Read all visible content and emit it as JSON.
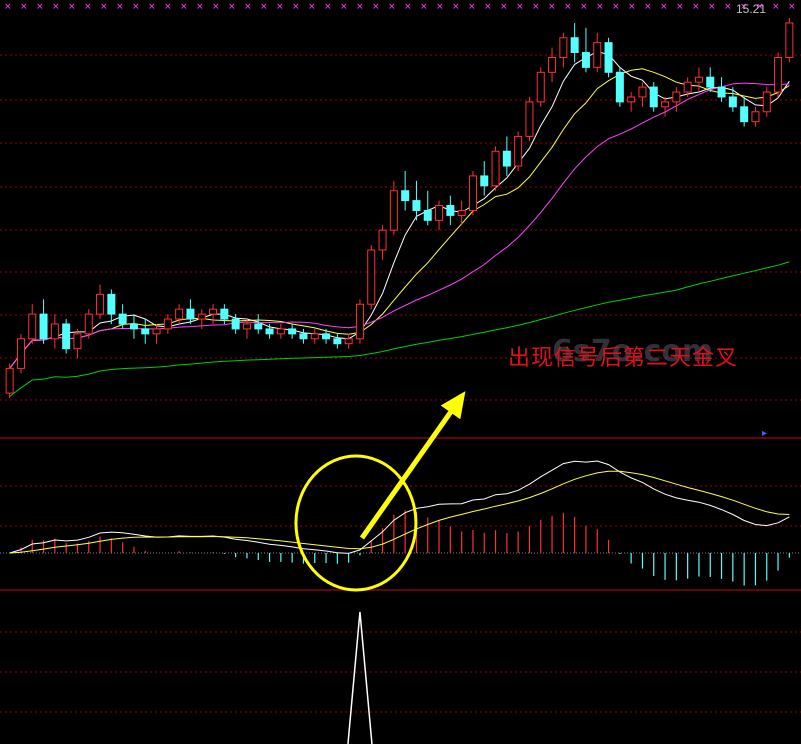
{
  "header": {
    "price_label": "15.21"
  },
  "annotation": {
    "text": "出现信号后第二天金叉",
    "color": "#e0101a"
  },
  "watermark": {
    "text": "6s7o.com"
  },
  "colors": {
    "background": "#000000",
    "up": "#ff3030",
    "down": "#54ffff",
    "ma_short": "#ffffff",
    "ma_mid": "#ffff40",
    "ma_long": "#ff40ff",
    "ma_longest": "#00d000",
    "dif": "#ffffff",
    "dea": "#ffff40",
    "grid": "#a00000",
    "highlight": "#ffff00",
    "signal": "#ffffff"
  },
  "chart_data": [
    {
      "type": "candlestick",
      "panel": "price",
      "grid": true,
      "ohlc": [
        [
          8.6,
          9.2,
          8.5,
          9.1
        ],
        [
          9.1,
          9.8,
          9.0,
          9.7
        ],
        [
          9.7,
          10.4,
          9.6,
          10.2
        ],
        [
          10.2,
          10.5,
          9.6,
          9.7
        ],
        [
          9.7,
          10.2,
          9.5,
          10.0
        ],
        [
          10.0,
          10.1,
          9.4,
          9.5
        ],
        [
          9.5,
          9.9,
          9.3,
          9.8
        ],
        [
          9.8,
          10.3,
          9.7,
          10.2
        ],
        [
          10.2,
          10.8,
          10.1,
          10.6
        ],
        [
          10.6,
          10.7,
          10.0,
          10.2
        ],
        [
          10.2,
          10.4,
          9.9,
          10.0
        ],
        [
          10.0,
          10.2,
          9.7,
          9.9
        ],
        [
          9.9,
          10.1,
          9.6,
          9.8
        ],
        [
          9.8,
          10.0,
          9.6,
          9.9
        ],
        [
          9.9,
          10.2,
          9.8,
          10.1
        ],
        [
          10.1,
          10.4,
          10.0,
          10.3
        ],
        [
          10.3,
          10.5,
          10.0,
          10.1
        ],
        [
          10.1,
          10.3,
          9.9,
          10.2
        ],
        [
          10.2,
          10.4,
          10.0,
          10.3
        ],
        [
          10.3,
          10.4,
          10.0,
          10.1
        ],
        [
          10.1,
          10.2,
          9.8,
          9.9
        ],
        [
          9.9,
          10.1,
          9.7,
          10.0
        ],
        [
          10.0,
          10.2,
          9.8,
          9.9
        ],
        [
          9.9,
          10.0,
          9.7,
          9.8
        ],
        [
          9.8,
          10.0,
          9.7,
          9.9
        ],
        [
          9.9,
          10.0,
          9.7,
          9.8
        ],
        [
          9.8,
          9.9,
          9.6,
          9.7
        ],
        [
          9.7,
          9.9,
          9.6,
          9.8
        ],
        [
          9.8,
          9.9,
          9.6,
          9.7
        ],
        [
          9.7,
          9.8,
          9.5,
          9.6
        ],
        [
          9.6,
          9.8,
          9.5,
          9.7
        ],
        [
          9.7,
          10.5,
          9.6,
          10.4
        ],
        [
          10.4,
          11.6,
          10.3,
          11.5
        ],
        [
          11.5,
          12.0,
          11.3,
          11.9
        ],
        [
          11.9,
          12.9,
          11.8,
          12.7
        ],
        [
          12.7,
          13.1,
          12.3,
          12.5
        ],
        [
          12.5,
          12.9,
          12.1,
          12.3
        ],
        [
          12.3,
          12.7,
          12.0,
          12.1
        ],
        [
          12.1,
          12.5,
          11.9,
          12.4
        ],
        [
          12.4,
          12.6,
          12.0,
          12.2
        ],
        [
          12.2,
          12.5,
          12.0,
          12.3
        ],
        [
          12.3,
          13.1,
          12.2,
          13.0
        ],
        [
          13.0,
          13.3,
          12.6,
          12.8
        ],
        [
          12.8,
          13.6,
          12.7,
          13.5
        ],
        [
          13.5,
          13.8,
          13.0,
          13.2
        ],
        [
          13.2,
          13.9,
          13.1,
          13.8
        ],
        [
          13.8,
          14.6,
          13.7,
          14.5
        ],
        [
          14.5,
          15.2,
          14.4,
          15.1
        ],
        [
          15.1,
          15.6,
          14.9,
          15.4
        ],
        [
          15.4,
          15.9,
          15.2,
          15.8
        ],
        [
          15.8,
          16.1,
          15.3,
          15.5
        ],
        [
          15.5,
          16.0,
          15.1,
          15.2
        ],
        [
          15.2,
          15.9,
          15.1,
          15.7
        ],
        [
          15.7,
          15.8,
          15.0,
          15.1
        ],
        [
          15.1,
          15.2,
          14.4,
          14.5
        ],
        [
          14.5,
          14.7,
          14.3,
          14.6
        ],
        [
          14.6,
          14.9,
          14.4,
          14.8
        ],
        [
          14.8,
          14.9,
          14.3,
          14.4
        ],
        [
          14.4,
          14.6,
          14.2,
          14.5
        ],
        [
          14.5,
          14.8,
          14.3,
          14.7
        ],
        [
          14.7,
          15.0,
          14.6,
          14.9
        ],
        [
          14.9,
          15.2,
          14.7,
          15.0
        ],
        [
          15.0,
          15.2,
          14.7,
          14.8
        ],
        [
          14.8,
          15.0,
          14.5,
          14.6
        ],
        [
          14.6,
          14.8,
          14.3,
          14.4
        ],
        [
          14.4,
          14.6,
          14.0,
          14.1
        ],
        [
          14.1,
          14.4,
          14.0,
          14.3
        ],
        [
          14.3,
          14.8,
          14.2,
          14.7
        ],
        [
          14.7,
          15.5,
          14.6,
          15.4
        ],
        [
          15.4,
          16.2,
          15.3,
          16.1
        ]
      ],
      "ma_curves": [
        "MA5",
        "MA10",
        "MA20",
        "MA60"
      ]
    },
    {
      "type": "line",
      "panel": "macd",
      "series": [
        {
          "key": "dif"
        },
        {
          "key": "dea"
        }
      ],
      "histogram": true,
      "zero_line": true
    },
    {
      "type": "line",
      "panel": "signal",
      "peak_index": 31,
      "peak_value": 1
    }
  ]
}
